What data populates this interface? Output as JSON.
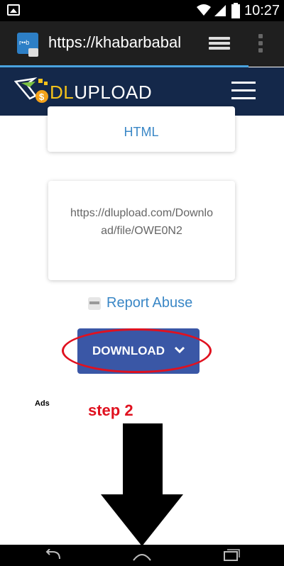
{
  "status_bar": {
    "time": "10:27",
    "icons": [
      "image-icon",
      "wifi-icon",
      "signal-icon",
      "battery-icon"
    ]
  },
  "browser": {
    "url": "https://khabarbabal",
    "site_icon_text": "r••b"
  },
  "site": {
    "logo_text_dl": "DL",
    "logo_text_upload": "UPLOAD",
    "brand_color": "#14284a",
    "accent_color": "#f4c21a"
  },
  "content": {
    "html_label": "HTML",
    "link_text": "https://dlupload.com/Download/file/OWE0N2",
    "report_abuse": "Report Abuse",
    "download_label": "DOWNLOAD",
    "download_color": "#3a57a6"
  },
  "annotations": {
    "ads_label": "Ads",
    "step_label": "step 2",
    "highlight_color": "#e0111f"
  },
  "system_nav": {
    "buttons": [
      "back-icon",
      "home-icon",
      "recents-icon"
    ]
  }
}
